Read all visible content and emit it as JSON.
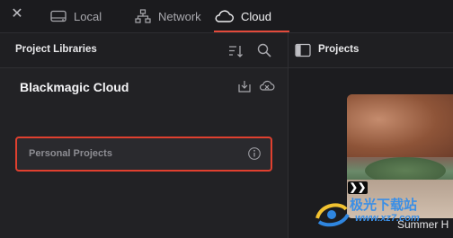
{
  "tabs": [
    {
      "label": "Local",
      "icon": "drive-icon"
    },
    {
      "label": "Network",
      "icon": "network-icon"
    },
    {
      "label": "Cloud",
      "icon": "cloud-icon",
      "active": true
    }
  ],
  "accent_color": "#e24a3b",
  "left_panel": {
    "title": "Project Libraries",
    "section_title": "Blackmagic Cloud",
    "items": [
      {
        "label": "Personal Projects",
        "selected": true
      }
    ]
  },
  "right_panel": {
    "title": "Projects",
    "thumbnail_caption": "Summer H"
  },
  "watermark": {
    "text": "极光下载站",
    "sub": "www.xz7.com"
  }
}
